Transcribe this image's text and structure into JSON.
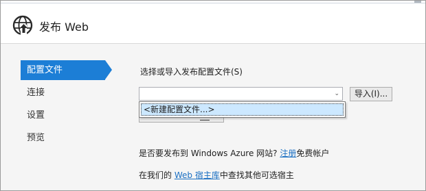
{
  "window": {
    "title": "发布 Web",
    "icon": "globe-publish-icon"
  },
  "nav": {
    "items": [
      {
        "label": "配置文件",
        "active": true
      },
      {
        "label": "连接",
        "active": false
      },
      {
        "label": "设置",
        "active": false
      },
      {
        "label": "预览",
        "active": false
      }
    ]
  },
  "profile": {
    "instruction": "选择或导入发布配置文件(S)",
    "combo_value": "",
    "dropdown_arrow": "⌄",
    "import_button": "导入(I)...",
    "dropdown_options": [
      "<新建配置文件...>"
    ]
  },
  "azure": {
    "prefix": "是否要发布到 Windows Azure 网站?",
    "link": "注册",
    "suffix": "免费帐户"
  },
  "hosting": {
    "prefix": "在我们的",
    "link": "Web 宿主库",
    "suffix": "中查找其他可选宿主"
  },
  "colors": {
    "accent": "#1c7ed6",
    "selection": "#cce8ff",
    "link": "#1a6fc2"
  }
}
